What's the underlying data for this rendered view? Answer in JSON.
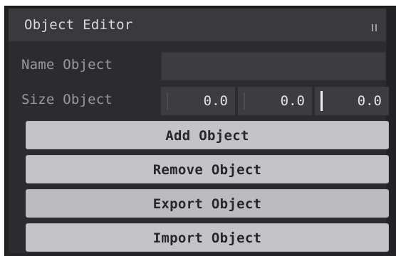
{
  "window": {
    "title": "Object Editor",
    "grip_icon": "drag-handle-icon"
  },
  "fields": {
    "name_label": "Name Object",
    "name_value": "",
    "size_label": "Size Object",
    "size_x": "0.0",
    "size_y": "0.0",
    "size_z": "0.0"
  },
  "buttons": {
    "add": "Add Object",
    "remove": "Remove Object",
    "export": "Export Object",
    "import": "Import Object"
  },
  "colors": {
    "window_bg": "#232325",
    "titlebar_bg": "#3a3a3d",
    "field_bg": "#3d3d40",
    "button_bg": "#c4c4c8"
  }
}
